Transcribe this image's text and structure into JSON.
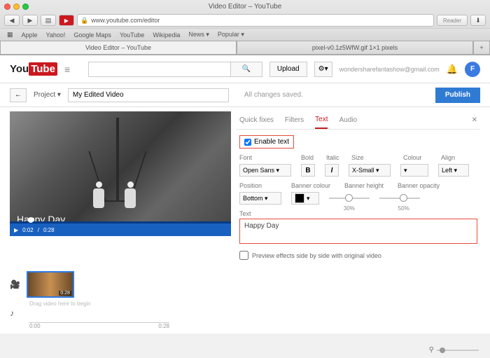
{
  "browser": {
    "window_title": "Video Editor – YouTube",
    "url": "www.youtube.com/editor",
    "reader": "Reader",
    "bookmarks": [
      "Apple",
      "Yahoo!",
      "Google Maps",
      "YouTube",
      "Wikipedia",
      "News ▾",
      "Popular ▾"
    ],
    "tabs": [
      {
        "label": "Video Editor – YouTube",
        "active": true
      },
      {
        "label": "pixel-v0.1z5WfW.gif 1×1 pixels",
        "active": false
      }
    ]
  },
  "header": {
    "logo_you": "You",
    "logo_tube": "Tube",
    "search_placeholder": "",
    "upload": "Upload",
    "user_email": "wondersharefantashow@gmail.com",
    "avatar_letter": "F"
  },
  "project": {
    "back": "←",
    "label": "Project ▾",
    "name": "My Edited Video",
    "saved": "All changes saved.",
    "publish": "Publish"
  },
  "video": {
    "overlay_text": "Happy Day",
    "time_current": "0:02",
    "time_total": "0:28"
  },
  "panel": {
    "tabs": {
      "quick": "Quick fixes",
      "filters": "Filters",
      "text": "Text",
      "audio": "Audio"
    },
    "enable_text": "Enable text",
    "labels": {
      "font": "Font",
      "bold": "Bold",
      "italic": "Italic",
      "size": "Size",
      "colour": "Colour",
      "align": "Align",
      "position": "Position",
      "banner_colour": "Banner colour",
      "banner_height": "Banner height",
      "banner_opacity": "Banner opacity",
      "text": "Text"
    },
    "values": {
      "font": "Open Sans ▾",
      "bold": "B",
      "italic": "I",
      "size": "X-Small ▾",
      "colour": "▾",
      "align": "Left ▾",
      "position": "Bottom ▾",
      "banner_colour": "▾",
      "banner_height": "30%",
      "banner_opacity": "50%",
      "text": "Happy Day"
    },
    "preview_label": "Preview effects side by side with original video"
  },
  "timeline": {
    "clip_duration": "0:28",
    "hint": "Drag video here to begin",
    "ruler_start": "0:00",
    "ruler_end": "0:28"
  },
  "zoom_icon": "⚲"
}
